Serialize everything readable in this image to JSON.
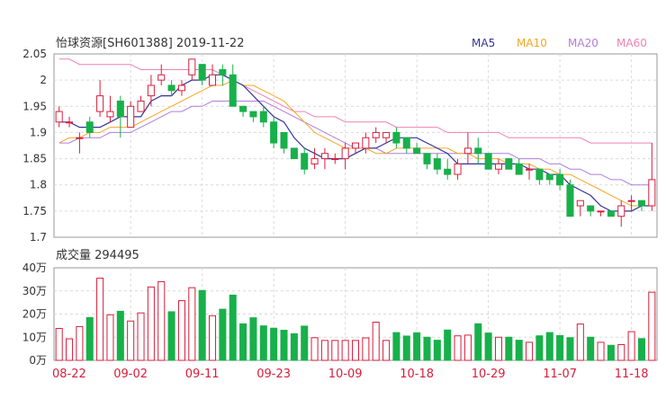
{
  "chart_data": [
    {
      "type": "candlestick",
      "title": "怡球资源[SH601388] 2019-11-22",
      "ylim": [
        1.7,
        2.05
      ],
      "y_ticks": [
        "2.05",
        "2",
        "1.95",
        "1.9",
        "1.85",
        "1.8",
        "1.75",
        "1.7"
      ],
      "legend": [
        "MA5",
        "MA10",
        "MA20",
        "MA60"
      ],
      "legend_colors": [
        "#333399",
        "#f5a623",
        "#b07ddb",
        "#ee82b4"
      ],
      "colors": {
        "up": "#d81e3c",
        "down": "#18b04a"
      },
      "candles": [
        [
          1.92,
          1.94,
          1.91,
          1.95
        ],
        [
          1.92,
          1.92,
          1.91,
          1.93
        ],
        [
          1.89,
          1.89,
          1.86,
          1.9
        ],
        [
          1.92,
          1.9,
          1.89,
          1.93
        ],
        [
          1.94,
          1.97,
          1.93,
          2.0
        ],
        [
          1.93,
          1.94,
          1.92,
          1.97
        ],
        [
          1.96,
          1.93,
          1.89,
          1.97
        ],
        [
          1.91,
          1.95,
          1.91,
          1.96
        ],
        [
          1.94,
          1.96,
          1.94,
          1.97
        ],
        [
          1.97,
          1.99,
          1.95,
          2.01
        ],
        [
          2.0,
          2.01,
          1.99,
          2.03
        ],
        [
          1.99,
          1.98,
          1.97,
          2.0
        ],
        [
          1.98,
          1.99,
          1.97,
          2.0
        ],
        [
          2.01,
          2.04,
          2.0,
          2.04
        ],
        [
          2.03,
          2.0,
          1.99,
          2.03
        ],
        [
          1.99,
          2.01,
          1.99,
          2.03
        ],
        [
          2.02,
          2.01,
          1.99,
          2.03
        ],
        [
          2.01,
          1.95,
          1.95,
          2.03
        ],
        [
          1.95,
          1.94,
          1.93,
          1.95
        ],
        [
          1.94,
          1.93,
          1.92,
          1.94
        ],
        [
          1.94,
          1.92,
          1.91,
          1.95
        ],
        [
          1.92,
          1.88,
          1.87,
          1.93
        ],
        [
          1.9,
          1.87,
          1.86,
          1.9
        ],
        [
          1.87,
          1.85,
          1.85,
          1.87
        ],
        [
          1.86,
          1.83,
          1.82,
          1.87
        ],
        [
          1.84,
          1.85,
          1.83,
          1.87
        ],
        [
          1.85,
          1.86,
          1.83,
          1.87
        ],
        [
          1.85,
          1.85,
          1.84,
          1.86
        ],
        [
          1.85,
          1.87,
          1.83,
          1.88
        ],
        [
          1.87,
          1.88,
          1.86,
          1.88
        ],
        [
          1.87,
          1.89,
          1.86,
          1.9
        ],
        [
          1.89,
          1.9,
          1.88,
          1.91
        ],
        [
          1.89,
          1.9,
          1.88,
          1.9
        ],
        [
          1.9,
          1.88,
          1.87,
          1.91
        ],
        [
          1.89,
          1.87,
          1.86,
          1.89
        ],
        [
          1.87,
          1.86,
          1.86,
          1.88
        ],
        [
          1.86,
          1.84,
          1.83,
          1.86
        ],
        [
          1.85,
          1.83,
          1.82,
          1.86
        ],
        [
          1.83,
          1.82,
          1.81,
          1.85
        ],
        [
          1.82,
          1.84,
          1.81,
          1.85
        ],
        [
          1.86,
          1.87,
          1.84,
          1.9
        ],
        [
          1.87,
          1.86,
          1.84,
          1.89
        ],
        [
          1.86,
          1.83,
          1.83,
          1.86
        ],
        [
          1.83,
          1.84,
          1.82,
          1.85
        ],
        [
          1.85,
          1.83,
          1.83,
          1.85
        ],
        [
          1.84,
          1.82,
          1.82,
          1.85
        ],
        [
          1.83,
          1.83,
          1.81,
          1.84
        ],
        [
          1.83,
          1.81,
          1.8,
          1.83
        ],
        [
          1.82,
          1.81,
          1.8,
          1.82
        ],
        [
          1.82,
          1.8,
          1.79,
          1.83
        ],
        [
          1.8,
          1.74,
          1.74,
          1.81
        ],
        [
          1.76,
          1.77,
          1.74,
          1.77
        ],
        [
          1.76,
          1.75,
          1.74,
          1.76
        ],
        [
          1.75,
          1.75,
          1.74,
          1.75
        ],
        [
          1.75,
          1.74,
          1.74,
          1.75
        ],
        [
          1.74,
          1.76,
          1.72,
          1.77
        ],
        [
          1.77,
          1.77,
          1.75,
          1.78
        ],
        [
          1.77,
          1.76,
          1.75,
          1.77
        ],
        [
          1.76,
          1.81,
          1.75,
          1.88
        ]
      ],
      "ma5": [
        1.92,
        1.92,
        1.91,
        1.91,
        1.91,
        1.92,
        1.93,
        1.93,
        1.93,
        1.96,
        1.97,
        1.97,
        1.99,
        2.0,
        2.0,
        2.01,
        2.01,
        2.0,
        1.99,
        1.97,
        1.95,
        1.93,
        1.92,
        1.89,
        1.87,
        1.86,
        1.85,
        1.85,
        1.85,
        1.86,
        1.87,
        1.87,
        1.88,
        1.89,
        1.89,
        1.89,
        1.88,
        1.87,
        1.86,
        1.84,
        1.84,
        1.84,
        1.84,
        1.84,
        1.84,
        1.84,
        1.83,
        1.83,
        1.82,
        1.82,
        1.8,
        1.79,
        1.78,
        1.76,
        1.75,
        1.75,
        1.75,
        1.76,
        1.76
      ],
      "ma10": [
        1.88,
        1.89,
        1.89,
        1.9,
        1.9,
        1.91,
        1.91,
        1.91,
        1.92,
        1.93,
        1.94,
        1.95,
        1.96,
        1.97,
        1.98,
        1.99,
        1.99,
        2.0,
        1.99,
        1.99,
        1.98,
        1.97,
        1.96,
        1.94,
        1.92,
        1.9,
        1.89,
        1.88,
        1.87,
        1.87,
        1.87,
        1.86,
        1.86,
        1.87,
        1.87,
        1.87,
        1.87,
        1.87,
        1.87,
        1.86,
        1.86,
        1.85,
        1.85,
        1.85,
        1.84,
        1.84,
        1.84,
        1.83,
        1.83,
        1.82,
        1.82,
        1.81,
        1.8,
        1.79,
        1.78,
        1.77,
        1.76,
        1.76,
        1.76
      ],
      "ma20": [
        1.88,
        1.88,
        1.89,
        1.89,
        1.89,
        1.9,
        1.9,
        1.9,
        1.91,
        1.92,
        1.93,
        1.94,
        1.94,
        1.95,
        1.95,
        1.96,
        1.96,
        1.96,
        1.96,
        1.96,
        1.96,
        1.95,
        1.94,
        1.93,
        1.92,
        1.91,
        1.9,
        1.89,
        1.88,
        1.87,
        1.87,
        1.87,
        1.86,
        1.86,
        1.86,
        1.86,
        1.86,
        1.86,
        1.86,
        1.86,
        1.86,
        1.86,
        1.86,
        1.86,
        1.86,
        1.85,
        1.85,
        1.85,
        1.84,
        1.84,
        1.83,
        1.83,
        1.82,
        1.82,
        1.81,
        1.81,
        1.8,
        1.8,
        1.8
      ],
      "ma60": [
        2.04,
        2.04,
        2.03,
        2.03,
        2.03,
        2.03,
        2.03,
        2.03,
        2.02,
        2.02,
        2.02,
        2.02,
        2.02,
        2.02,
        2.02,
        2.02,
        2.01,
        2.0,
        1.99,
        1.98,
        1.97,
        1.96,
        1.95,
        1.94,
        1.94,
        1.93,
        1.93,
        1.93,
        1.92,
        1.92,
        1.92,
        1.92,
        1.92,
        1.91,
        1.91,
        1.91,
        1.91,
        1.91,
        1.9,
        1.9,
        1.9,
        1.9,
        1.9,
        1.9,
        1.89,
        1.89,
        1.89,
        1.89,
        1.89,
        1.89,
        1.89,
        1.89,
        1.88,
        1.88,
        1.88,
        1.88,
        1.88,
        1.88,
        1.88
      ]
    },
    {
      "type": "bar",
      "title": "成交量 294495",
      "ylim": [
        0,
        400000
      ],
      "y_ticks": [
        "40万",
        "30万",
        "20万",
        "10万",
        "0万"
      ],
      "volumes": [
        138000,
        93000,
        146000,
        185000,
        355000,
        197000,
        212000,
        170000,
        205000,
        317000,
        340000,
        210000,
        258000,
        314000,
        302000,
        193000,
        221000,
        282000,
        158000,
        184000,
        149000,
        139000,
        130000,
        115000,
        148000,
        98000,
        86000,
        86000,
        86000,
        86000,
        97000,
        165000,
        86000,
        120000,
        105000,
        119000,
        100000,
        87000,
        131000,
        106000,
        109000,
        158000,
        118000,
        100000,
        100000,
        87000,
        78000,
        106000,
        120000,
        107000,
        98000,
        157000,
        100000,
        78000,
        65000,
        68000,
        124000,
        94000,
        294495
      ]
    }
  ],
  "x_labels": [
    {
      "i": 0,
      "label": "08-22"
    },
    {
      "i": 7,
      "label": "09-02"
    },
    {
      "i": 14,
      "label": "09-11"
    },
    {
      "i": 21,
      "label": "09-23"
    },
    {
      "i": 28,
      "label": "10-09"
    },
    {
      "i": 35,
      "label": "10-18"
    },
    {
      "i": 42,
      "label": "10-29"
    },
    {
      "i": 49,
      "label": "11-07"
    },
    {
      "i": 56,
      "label": "11-18"
    }
  ]
}
